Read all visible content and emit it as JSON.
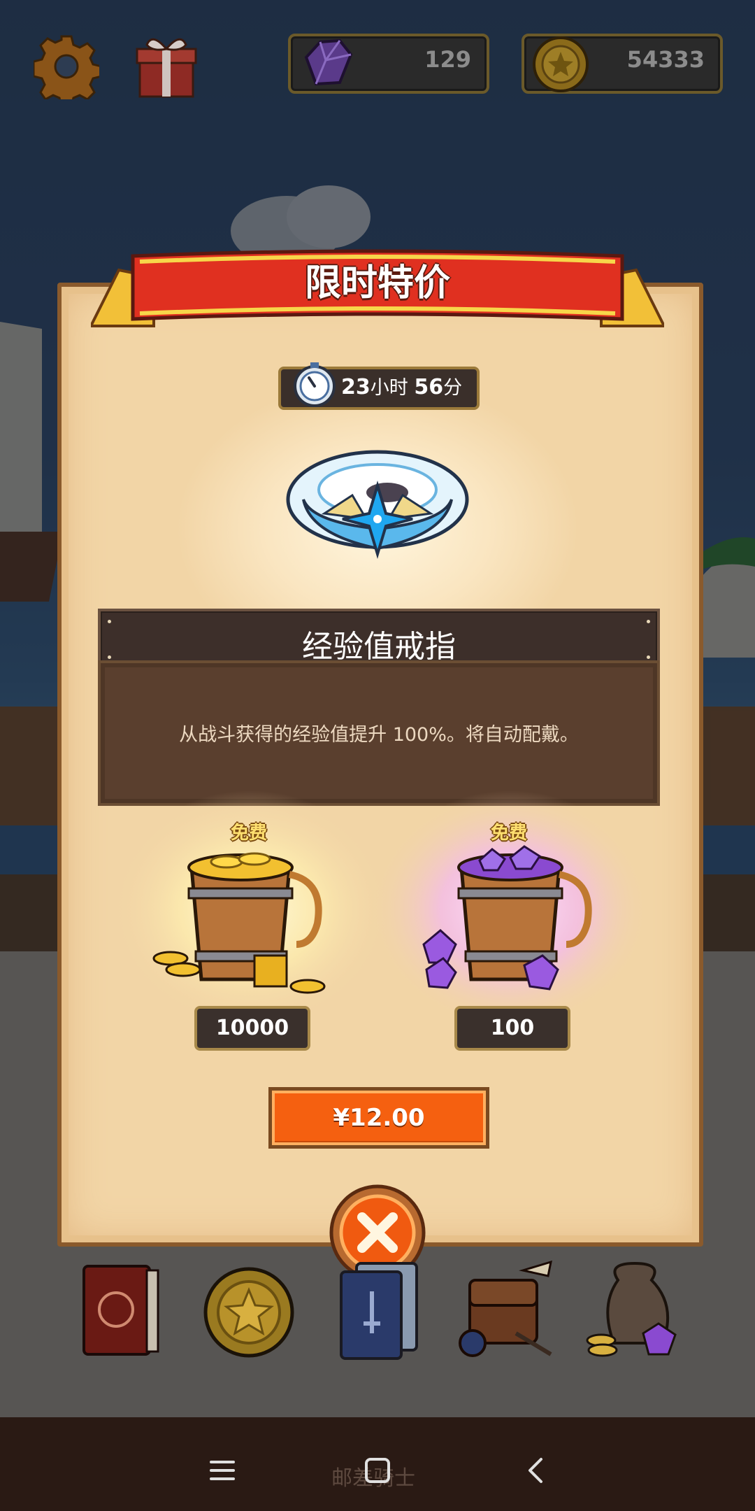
{
  "top_bar": {
    "settings_icon": "gear-icon",
    "gift_icon": "gift-box-icon",
    "gems": {
      "icon": "purple-gem-icon",
      "value": "129"
    },
    "coins": {
      "icon": "gold-coin-icon",
      "value": "54333"
    }
  },
  "offer": {
    "title": "限时特价",
    "timer": {
      "hours": "23",
      "hours_unit": "小时 ",
      "minutes": "56",
      "minutes_unit": "分"
    },
    "item_name": "经验值戒指",
    "item_icon": "winged-ring-icon",
    "description": "从战斗获得的经验值提升 100%。将自动配戴。",
    "rewards": [
      {
        "label": "免费",
        "icon": "gold-bucket-icon",
        "amount": "10000"
      },
      {
        "label": "免费",
        "icon": "gem-bucket-icon",
        "amount": "100"
      }
    ],
    "price": "¥12.00",
    "close_icon": "close-icon"
  },
  "bottom_nav": [
    "book-icon",
    "star-coin-icon",
    "card-deck-icon",
    "satchel-icon",
    "treasure-bag-icon"
  ],
  "system_nav": {
    "watermark": "邮差骑士",
    "menu_icon": "menu-icon",
    "home_icon": "home-icon",
    "back_icon": "back-icon"
  },
  "colors": {
    "ribbon": "#e03020",
    "price_button": "#f56010",
    "panel": "#f2d5a6"
  }
}
